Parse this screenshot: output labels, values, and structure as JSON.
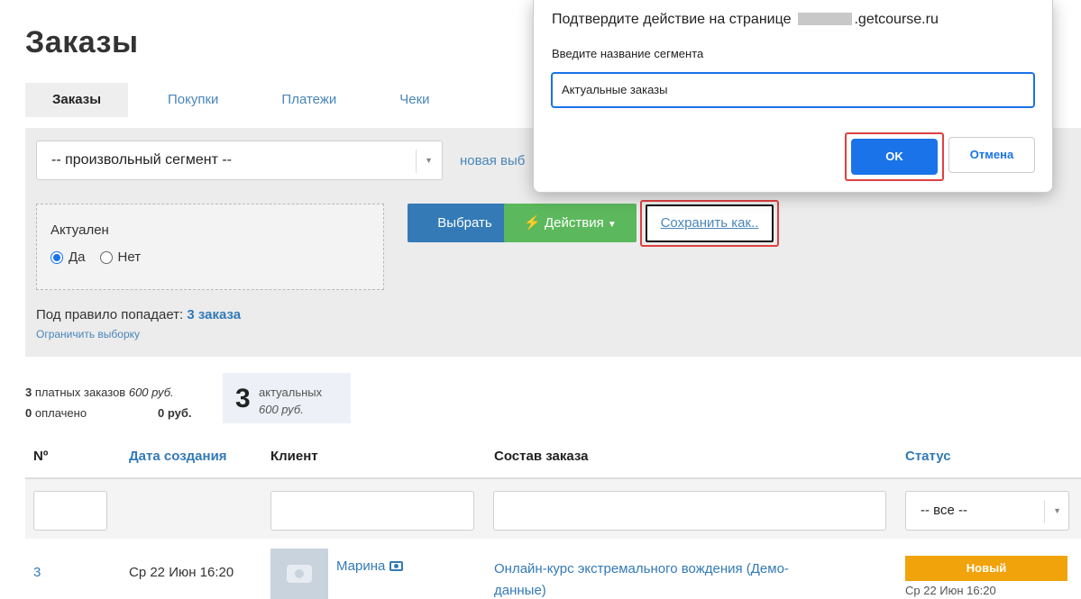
{
  "page_title": "Заказы",
  "tabs": [
    "Заказы",
    "Покупки",
    "Платежи",
    "Чеки"
  ],
  "filter": {
    "segment_select": "-- произвольный сегмент --",
    "new_selection_link": "новая выб",
    "rule_label": "Актуален",
    "radio_yes": "Да",
    "radio_no": "Нет",
    "radio_selected": "Да",
    "select_button": "Выбрать",
    "actions_button": "Действия",
    "save_as_button": "Сохранить как..",
    "rule_count_prefix": "Под правило попадает:",
    "rule_count_value": "3 заказа",
    "limit_link": "Ограничить выборку"
  },
  "stats": {
    "paid_count": "3",
    "paid_label": "платных заказов",
    "paid_amount": "600 руб.",
    "settled_count": "0",
    "settled_label": "оплачено",
    "settled_amount": "0 руб.",
    "actual_count": "3",
    "actual_label": "актуальных",
    "actual_amount": "600 руб."
  },
  "table": {
    "columns": [
      "Nº",
      "Дата создания",
      "Клиент",
      "Состав заказа",
      "Статус"
    ],
    "status_filter": "-- все --",
    "rows": [
      {
        "number": "3",
        "date": "Ср 22 Июн 16:20",
        "client": "Марина",
        "order_line1": "Онлайн-курс экстремального вождения (Демо-",
        "order_line2": "данные)",
        "status": "Новый",
        "status_date": "Ср 22 Июн 16:20"
      }
    ]
  },
  "dialog": {
    "title_prefix": "Подтвердите действие на странице",
    "title_domain": ".getcourse.ru",
    "prompt": "Введите название сегмента",
    "input_value": "Актуальные заказы",
    "ok": "OK",
    "cancel": "Отмена"
  },
  "colors": {
    "link": "#337ab7",
    "select_button": "#337ab7",
    "actions_button": "#5cb85c",
    "status_new": "#f0a30a",
    "dialog_primary": "#1a73e8",
    "highlight": "#e04040"
  }
}
